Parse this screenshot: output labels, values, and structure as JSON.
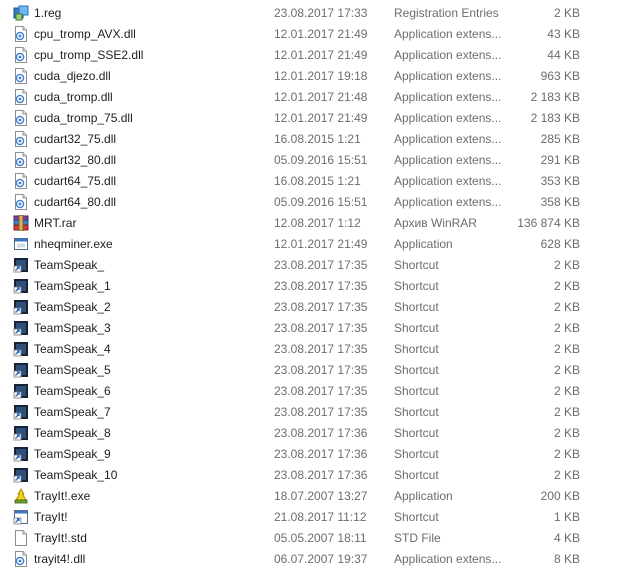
{
  "files": [
    {
      "name": "1.reg",
      "date": "23.08.2017 17:33",
      "type": "Registration Entries",
      "size": "2 KB",
      "icon": "registry-file-icon"
    },
    {
      "name": "cpu_tromp_AVX.dll",
      "date": "12.01.2017 21:49",
      "type": "Application extens...",
      "size": "43 KB",
      "icon": "dll-file-icon"
    },
    {
      "name": "cpu_tromp_SSE2.dll",
      "date": "12.01.2017 21:49",
      "type": "Application extens...",
      "size": "44 KB",
      "icon": "dll-file-icon"
    },
    {
      "name": "cuda_djezo.dll",
      "date": "12.01.2017 19:18",
      "type": "Application extens...",
      "size": "963 KB",
      "icon": "dll-file-icon"
    },
    {
      "name": "cuda_tromp.dll",
      "date": "12.01.2017 21:48",
      "type": "Application extens...",
      "size": "2 183 KB",
      "icon": "dll-file-icon"
    },
    {
      "name": "cuda_tromp_75.dll",
      "date": "12.01.2017 21:49",
      "type": "Application extens...",
      "size": "2 183 KB",
      "icon": "dll-file-icon"
    },
    {
      "name": "cudart32_75.dll",
      "date": "16.08.2015 1:21",
      "type": "Application extens...",
      "size": "285 KB",
      "icon": "dll-file-icon"
    },
    {
      "name": "cudart32_80.dll",
      "date": "05.09.2016 15:51",
      "type": "Application extens...",
      "size": "291 KB",
      "icon": "dll-file-icon"
    },
    {
      "name": "cudart64_75.dll",
      "date": "16.08.2015 1:21",
      "type": "Application extens...",
      "size": "353 KB",
      "icon": "dll-file-icon"
    },
    {
      "name": "cudart64_80.dll",
      "date": "05.09.2016 15:51",
      "type": "Application extens...",
      "size": "358 KB",
      "icon": "dll-file-icon"
    },
    {
      "name": "MRT.rar",
      "date": "12.08.2017 1:12",
      "type": "Архив WinRAR",
      "size": "136 874 KB",
      "icon": "winrar-archive-icon"
    },
    {
      "name": "nheqminer.exe",
      "date": "12.01.2017 21:49",
      "type": "Application",
      "size": "628 KB",
      "icon": "application-exe-icon"
    },
    {
      "name": "TeamSpeak_",
      "date": "23.08.2017 17:35",
      "type": "Shortcut",
      "size": "2 KB",
      "icon": "shortcut-icon"
    },
    {
      "name": "TeamSpeak_1",
      "date": "23.08.2017 17:35",
      "type": "Shortcut",
      "size": "2 KB",
      "icon": "shortcut-icon"
    },
    {
      "name": "TeamSpeak_2",
      "date": "23.08.2017 17:35",
      "type": "Shortcut",
      "size": "2 KB",
      "icon": "shortcut-icon"
    },
    {
      "name": "TeamSpeak_3",
      "date": "23.08.2017 17:35",
      "type": "Shortcut",
      "size": "2 KB",
      "icon": "shortcut-icon"
    },
    {
      "name": "TeamSpeak_4",
      "date": "23.08.2017 17:35",
      "type": "Shortcut",
      "size": "2 KB",
      "icon": "shortcut-icon"
    },
    {
      "name": "TeamSpeak_5",
      "date": "23.08.2017 17:35",
      "type": "Shortcut",
      "size": "2 KB",
      "icon": "shortcut-icon"
    },
    {
      "name": "TeamSpeak_6",
      "date": "23.08.2017 17:35",
      "type": "Shortcut",
      "size": "2 KB",
      "icon": "shortcut-icon"
    },
    {
      "name": "TeamSpeak_7",
      "date": "23.08.2017 17:35",
      "type": "Shortcut",
      "size": "2 KB",
      "icon": "shortcut-icon"
    },
    {
      "name": "TeamSpeak_8",
      "date": "23.08.2017 17:36",
      "type": "Shortcut",
      "size": "2 KB",
      "icon": "shortcut-icon"
    },
    {
      "name": "TeamSpeak_9",
      "date": "23.08.2017 17:36",
      "type": "Shortcut",
      "size": "2 KB",
      "icon": "shortcut-icon"
    },
    {
      "name": "TeamSpeak_10",
      "date": "23.08.2017 17:36",
      "type": "Shortcut",
      "size": "2 KB",
      "icon": "shortcut-icon"
    },
    {
      "name": "TrayIt!.exe",
      "date": "18.07.2007 13:27",
      "type": "Application",
      "size": "200 KB",
      "icon": "trayit-app-icon"
    },
    {
      "name": "TrayIt!",
      "date": "21.08.2017 11:12",
      "type": "Shortcut",
      "size": "1 KB",
      "icon": "trayit-shortcut-icon"
    },
    {
      "name": "TrayIt!.std",
      "date": "05.05.2007 18:11",
      "type": "STD File",
      "size": "4 KB",
      "icon": "blank-file-icon"
    },
    {
      "name": "trayit4!.dll",
      "date": "06.07.2007 19:37",
      "type": "Application extens...",
      "size": "8 KB",
      "icon": "dll-file-icon"
    }
  ]
}
